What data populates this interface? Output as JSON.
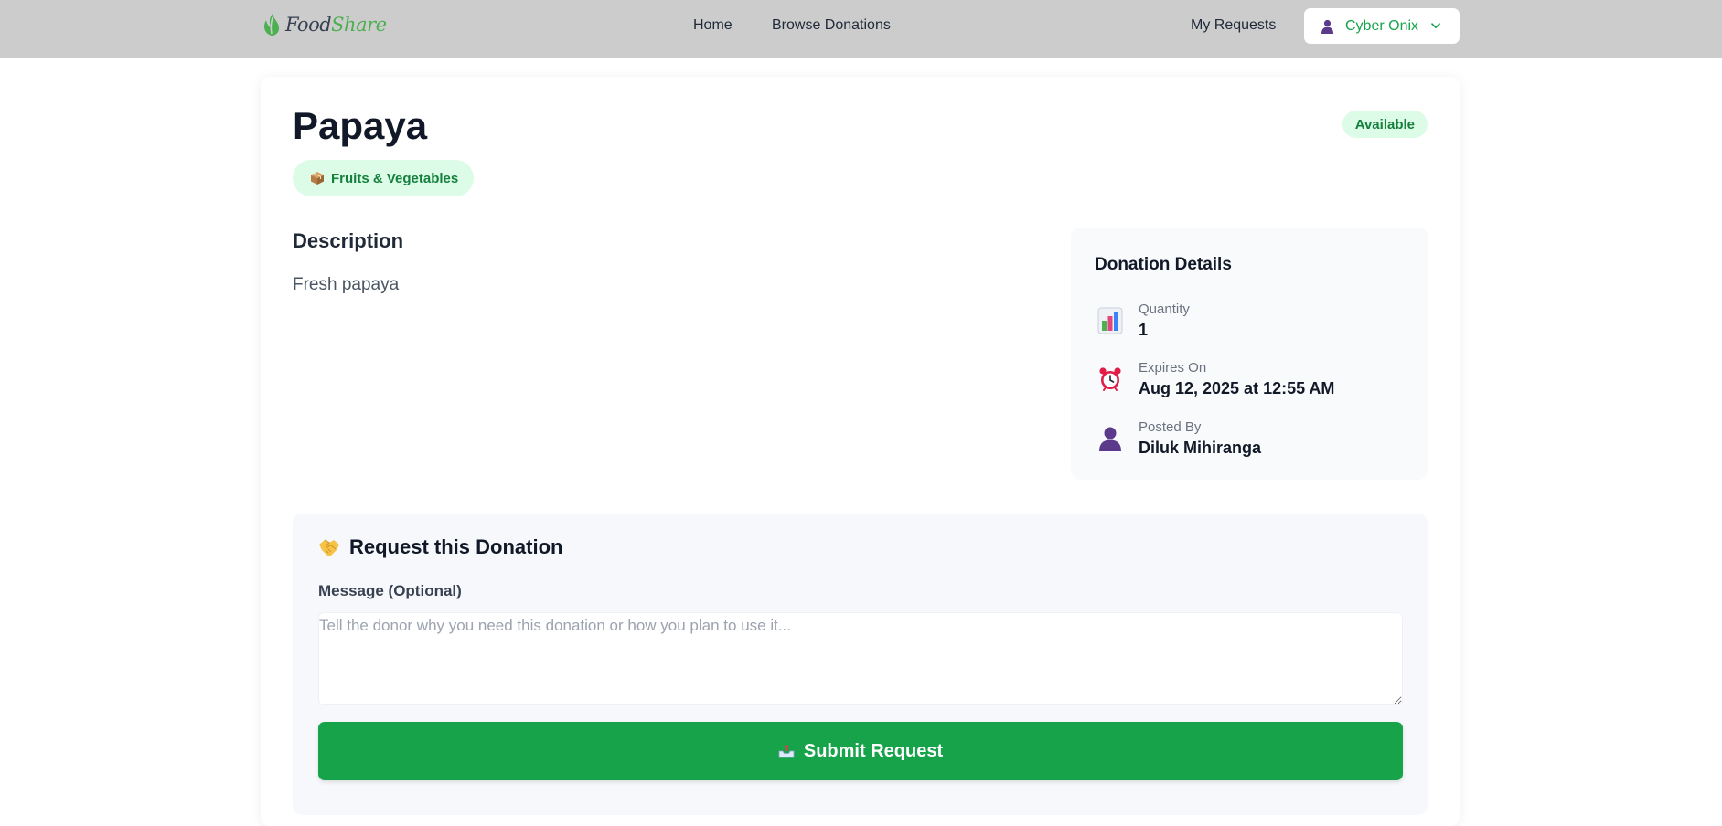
{
  "nav": {
    "logo_prefix": "Food",
    "logo_suffix": "Share",
    "links": [
      "Home",
      "Browse Donations"
    ],
    "my_requests": "My Requests",
    "user_name": "Cyber Onix"
  },
  "donation": {
    "title": "Papaya",
    "status": "Available",
    "category": "Fruits & Vegetables",
    "description_heading": "Description",
    "description": "Fresh papaya"
  },
  "details": {
    "heading": "Donation Details",
    "rows": [
      {
        "icon": "bar-chart-icon",
        "label": "Quantity",
        "value": "1"
      },
      {
        "icon": "alarm-clock-icon",
        "label": "Expires On",
        "value": "Aug 12, 2025 at 12:55 AM"
      },
      {
        "icon": "person-icon",
        "label": "Posted By",
        "value": "Diluk Mihiranga"
      }
    ]
  },
  "request": {
    "heading": "Request this Donation",
    "message_label": "Message (Optional)",
    "message_placeholder": "Tell the donor why you need this donation or how you plan to use it...",
    "message_value": "",
    "submit_label": "Submit Request"
  },
  "colors": {
    "navbar_bg": "#cccccc",
    "brand_green": "#16a34a",
    "badge_bg": "#dcfce7",
    "badge_text": "#15803d"
  }
}
